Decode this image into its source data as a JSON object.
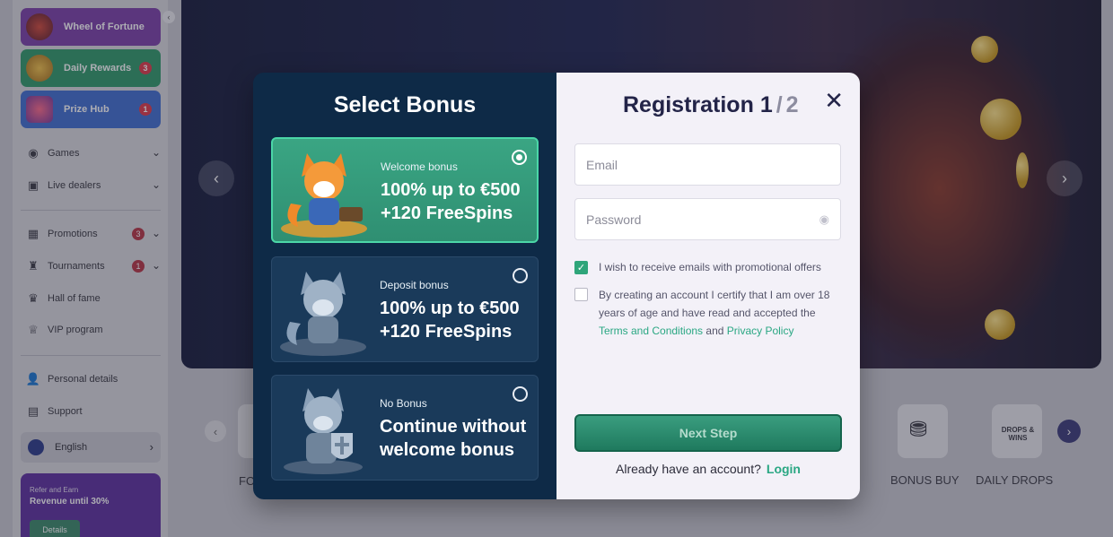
{
  "sidebar": {
    "collapse_icon": "chevron-left-icon",
    "promo_tiles": [
      {
        "label": "Wheel of Fortune",
        "badge": ""
      },
      {
        "label": "Daily Rewards",
        "badge": "3"
      },
      {
        "label": "Prize Hub",
        "badge": "1"
      }
    ],
    "nav": [
      {
        "label": "Games",
        "icon": "games-icon"
      },
      {
        "label": "Live dealers",
        "icon": "live-dealers-icon"
      },
      {
        "label": "Promotions",
        "icon": "gift-icon",
        "badge": "3"
      },
      {
        "label": "Tournaments",
        "icon": "trophy-icon",
        "badge": "1"
      },
      {
        "label": "Hall of fame",
        "icon": "crown-icon"
      },
      {
        "label": "VIP program",
        "icon": "vip-icon"
      },
      {
        "label": "Personal details",
        "icon": "user-icon"
      },
      {
        "label": "Support",
        "icon": "chat-icon"
      }
    ],
    "language": "English",
    "refer": {
      "kicker": "Refer and Earn",
      "title": "Revenue until 30%",
      "button": "Details"
    }
  },
  "categories": {
    "left_partial": "FO",
    "bonus_buy": "BONUS BUY",
    "daily_drops": "DAILY DROPS",
    "drops_tile_text": "DROPS & WINS"
  },
  "modal": {
    "select_title": "Select Bonus",
    "bonuses": [
      {
        "kicker": "Welcome bonus",
        "line1": "100% up to €500",
        "line2": "+120 FreeSpins",
        "selected": true
      },
      {
        "kicker": "Deposit bonus",
        "line1": "100% up to €500",
        "line2": "+120 FreeSpins",
        "selected": false
      },
      {
        "kicker": "No Bonus",
        "line1": "Continue without",
        "line2": "welcome bonus",
        "selected": false
      }
    ],
    "registration": {
      "title": "Registration",
      "step_current": "1",
      "step_sep": "/",
      "step_total": "2",
      "email_placeholder": "Email",
      "password_placeholder": "Password",
      "promo_opt_in": "I wish to receive emails with promotional offers",
      "terms_prefix": "By creating an account I certify that I am over 18 years of age and have read and accepted the",
      "terms_link": "Terms and Conditions",
      "terms_and": "and",
      "privacy_link": "Privacy Policy",
      "next_button": "Next Step",
      "already_text": "Already have an account?",
      "login_link": "Login"
    }
  },
  "colors": {
    "accent_green": "#2aa783",
    "modal_left_bg": "#0e2a47",
    "modal_right_bg": "#f3f1f8"
  }
}
